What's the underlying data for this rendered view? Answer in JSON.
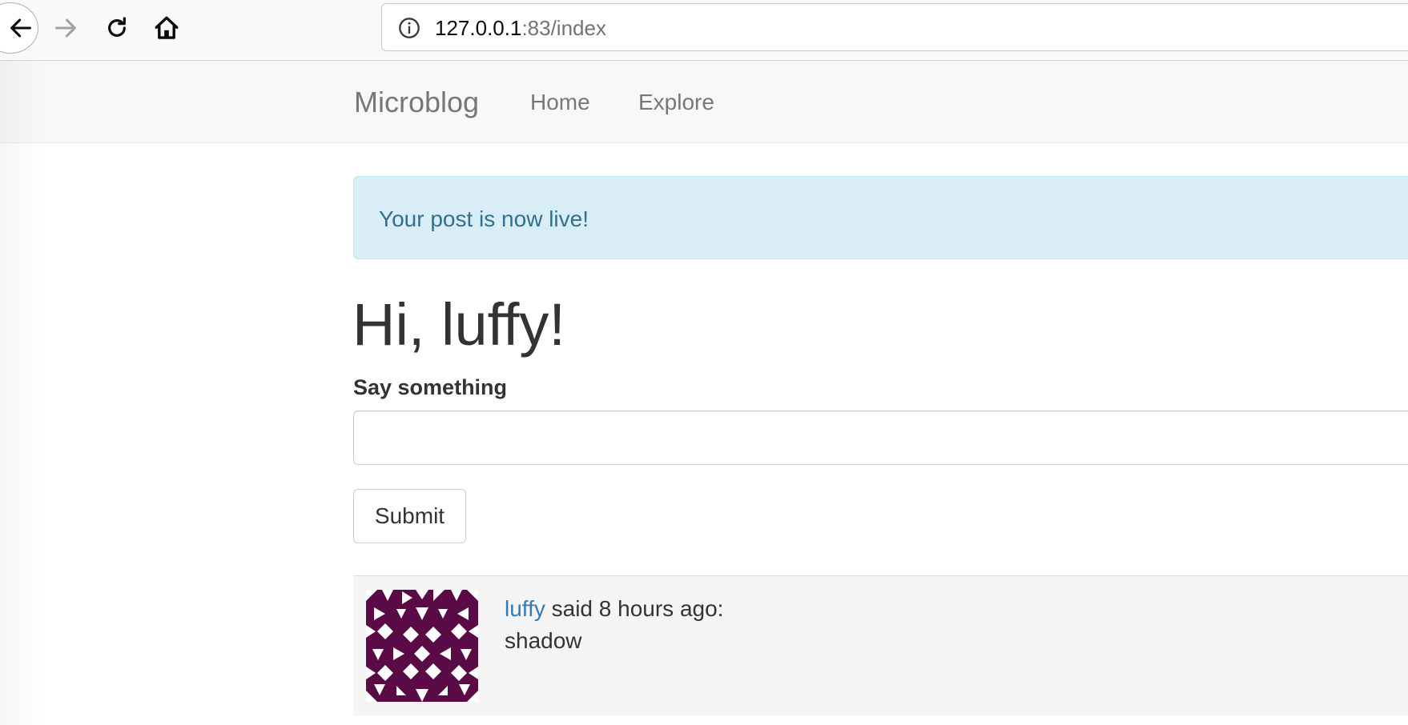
{
  "browser": {
    "url_host": "127.0.0.1",
    "url_rest": ":83/index"
  },
  "navbar": {
    "brand": "Microblog",
    "links": [
      {
        "label": "Home"
      },
      {
        "label": "Explore"
      }
    ]
  },
  "alert": {
    "message": "Your post is now live!"
  },
  "main": {
    "greeting": "Hi, luffy!",
    "form": {
      "label": "Say something",
      "value": "",
      "submit_label": "Submit"
    }
  },
  "posts": [
    {
      "author": "luffy",
      "time_text": " said 8 hours ago:",
      "body": "shadow"
    }
  ],
  "colors": {
    "link": "#337ab7",
    "alert_bg": "#d9edf7",
    "alert_text": "#31708f",
    "avatar_bg": "#5a0a45"
  }
}
